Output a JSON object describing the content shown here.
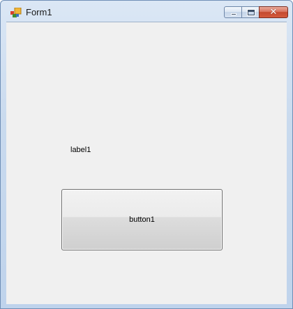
{
  "window": {
    "title": "Form1",
    "icon": "form-app-icon"
  },
  "caption_buttons": {
    "minimize_icon": "minimize-icon",
    "maximize_icon": "maximize-icon",
    "close_icon": "close-icon",
    "close_glyph": "✕"
  },
  "form": {
    "label_text": "label1",
    "button_text": "button1"
  },
  "colors": {
    "close_button": "#c44a2f",
    "client_background": "#f0f0f0",
    "frame": "#c9daee"
  }
}
